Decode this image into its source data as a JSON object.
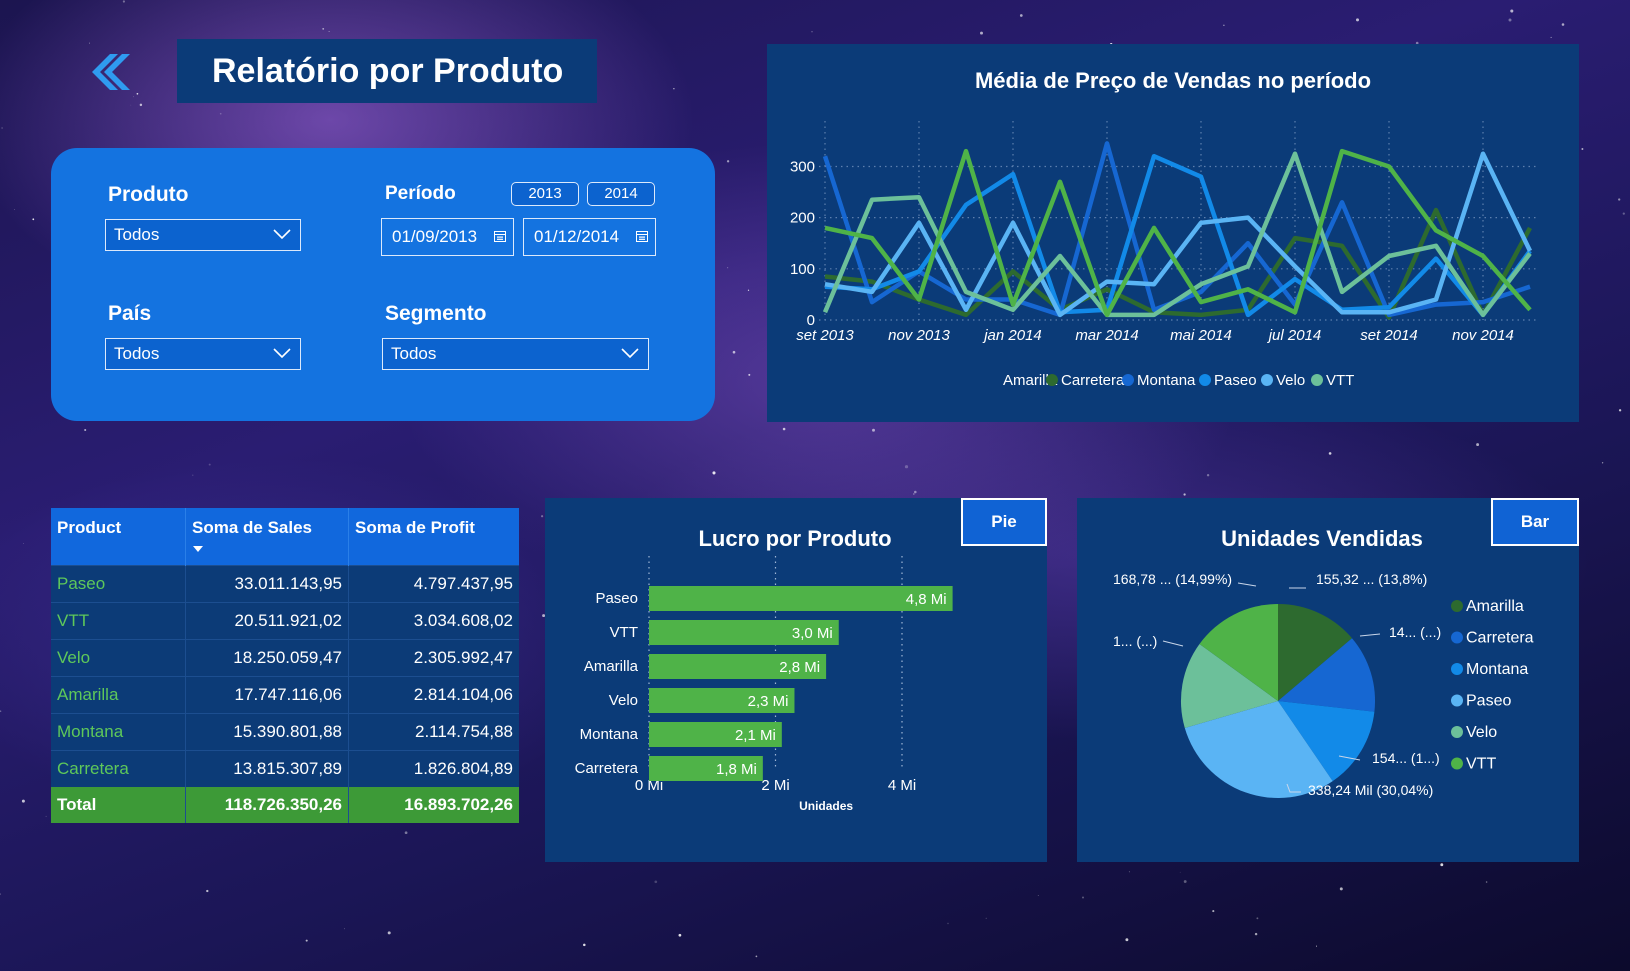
{
  "header": {
    "title": "Relatório por Produto",
    "back_icon": "double-chevron-left-icon"
  },
  "filters": {
    "produto": {
      "label": "Produto",
      "value": "Todos"
    },
    "periodo": {
      "label": "Período",
      "years": [
        "2013",
        "2014"
      ],
      "start": "01/09/2013",
      "end": "01/12/2014"
    },
    "pais": {
      "label": "País",
      "value": "Todos"
    },
    "segmento": {
      "label": "Segmento",
      "value": "Todos"
    }
  },
  "colors": {
    "Amarilla": "#2d6a2f",
    "Carretera": "#1667d2",
    "Montana": "#128ae8",
    "Paseo": "#5ab4f4",
    "Velo": "#6cc09a",
    "VTT": "#4fb348"
  },
  "table": {
    "headers": [
      "Product",
      "Soma de Sales",
      "Soma de Profit"
    ],
    "rows": [
      [
        "Paseo",
        "33.011.143,95",
        "4.797.437,95"
      ],
      [
        "VTT",
        "20.511.921,02",
        "3.034.608,02"
      ],
      [
        "Velo",
        "18.250.059,47",
        "2.305.992,47"
      ],
      [
        "Amarilla",
        "17.747.116,06",
        "2.814.104,06"
      ],
      [
        "Montana",
        "15.390.801,88",
        "2.114.754,88"
      ],
      [
        "Carretera",
        "13.815.307,89",
        "1.826.804,89"
      ]
    ],
    "total": [
      "Total",
      "118.726.350,26",
      "16.893.702,26"
    ]
  },
  "line_panel": {
    "title": "Média de Preço de Vendas no período"
  },
  "bar_panel": {
    "title": "Lucro por Produto",
    "toggle": "Pie"
  },
  "pie_panel": {
    "title": "Unidades Vendidas",
    "toggle": "Bar"
  },
  "chart_data": [
    {
      "type": "line",
      "title": "Média de Preço de Vendas no período",
      "x": [
        "set 2013",
        "out 2013",
        "nov 2013",
        "dez 2013",
        "jan 2014",
        "fev 2014",
        "mar 2014",
        "abr 2014",
        "mai 2014",
        "jun 2014",
        "jul 2014",
        "ago 2014",
        "set 2014",
        "out 2014",
        "nov 2014",
        "dez 2014"
      ],
      "xticks": [
        "set 2013",
        "nov 2013",
        "jan 2014",
        "mar 2014",
        "mai 2014",
        "jul 2014",
        "set 2014",
        "nov 2014"
      ],
      "ylim": [
        0,
        340
      ],
      "yticks": [
        0,
        100,
        200,
        300
      ],
      "legend_position": "bottom",
      "series": [
        {
          "name": "Amarilla",
          "values": [
            85,
            75,
            40,
            10,
            95,
            20,
            60,
            15,
            10,
            20,
            160,
            145,
            5,
            215,
            10,
            180
          ]
        },
        {
          "name": "Carretera",
          "values": [
            320,
            35,
            95,
            40,
            40,
            10,
            345,
            20,
            55,
            150,
            30,
            230,
            10,
            30,
            35,
            65
          ]
        },
        {
          "name": "Montana",
          "values": [
            65,
            60,
            95,
            225,
            285,
            15,
            20,
            320,
            280,
            10,
            80,
            20,
            25,
            120,
            10,
            135
          ]
        },
        {
          "name": "Paseo",
          "values": [
            70,
            55,
            190,
            20,
            190,
            10,
            75,
            70,
            190,
            200,
            105,
            15,
            15,
            40,
            325,
            135
          ]
        },
        {
          "name": "Velo",
          "values": [
            15,
            235,
            240,
            55,
            20,
            125,
            10,
            10,
            70,
            105,
            325,
            55,
            125,
            145,
            10,
            130
          ]
        },
        {
          "name": "VTT",
          "values": [
            180,
            160,
            40,
            330,
            30,
            270,
            10,
            180,
            35,
            60,
            15,
            330,
            300,
            175,
            125,
            20
          ]
        }
      ]
    },
    {
      "type": "bar",
      "title": "Lucro por Produto",
      "categories": [
        "Paseo",
        "VTT",
        "Amarilla",
        "Velo",
        "Montana",
        "Carretera"
      ],
      "values": [
        4.8,
        3.0,
        2.8,
        2.3,
        2.1,
        1.8
      ],
      "labels": [
        "4,8 Mi",
        "3,0 Mi",
        "2,8 Mi",
        "2,3 Mi",
        "2,1 Mi",
        "1,8 Mi"
      ],
      "xlim": [
        0,
        5.2
      ],
      "xticks": [
        "0 Mi",
        "2 Mi",
        "4 Mi"
      ],
      "xlabel": "Unidades",
      "grid": true
    },
    {
      "type": "pie",
      "title": "Unidades Vendidas",
      "slices": [
        {
          "name": "Amarilla",
          "value": 155.32,
          "label": "155,32 ... (13,8%)"
        },
        {
          "name": "Carretera",
          "value": 146.0,
          "label": "14... (...)"
        },
        {
          "name": "Montana",
          "value": 154.0,
          "label": "154... (1...)"
        },
        {
          "name": "Paseo",
          "value": 338.24,
          "label": "338,24 Mil (30,04%)"
        },
        {
          "name": "Velo",
          "value": 163.0,
          "label": "1... (...)"
        },
        {
          "name": "VTT",
          "value": 168.78,
          "label": "168,78 ... (14,99%)"
        }
      ],
      "legend_position": "right"
    }
  ]
}
